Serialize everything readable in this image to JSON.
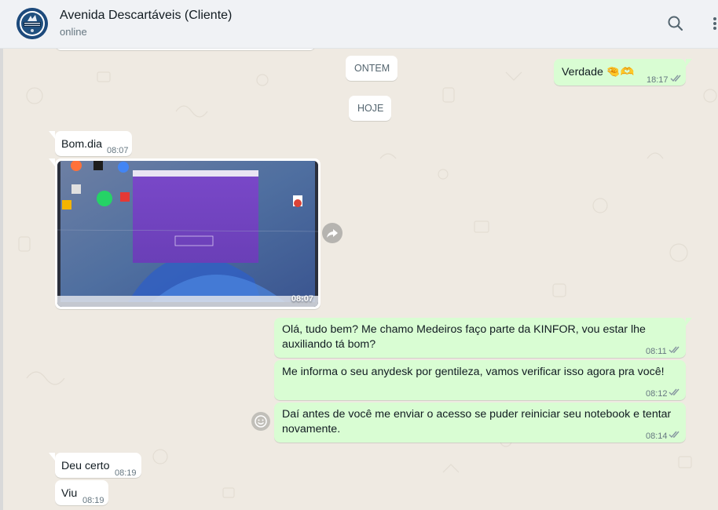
{
  "header": {
    "title": "Avenida Descartáveis (Cliente)",
    "status": "online",
    "search_icon": "search-icon",
    "menu_icon": "more-vertical-icon"
  },
  "chat": {
    "date_chips": [
      "ONTEM",
      "HOJE"
    ],
    "messages": [
      {
        "direction": "out",
        "text": "Verdade 🤏🫶",
        "time": "18:17",
        "status": "read"
      },
      {
        "direction": "in",
        "text": "Bom.dia",
        "time": "08:07"
      },
      {
        "direction": "in",
        "type": "image",
        "time": "08:07"
      },
      {
        "direction": "out",
        "text": "Olá, tudo bem? Me chamo Medeiros faço parte da KINFOR, vou estar lhe auxiliando tá bom?",
        "time": "08:11",
        "status": "read"
      },
      {
        "direction": "out",
        "text": "Me informa o seu anydesk por gentileza, vamos verificar isso agora pra você!",
        "time": "08:12",
        "status": "read"
      },
      {
        "direction": "out",
        "text": "Daí antes de você me enviar o acesso se puder reiniciar seu notebook e tentar novamente.",
        "time": "08:14",
        "status": "read"
      },
      {
        "direction": "in",
        "text": "Deu certo",
        "time": "08:19"
      },
      {
        "direction": "in",
        "text": "Viu",
        "time": "08:19"
      }
    ]
  },
  "colors": {
    "header_bg": "#f0f2f5",
    "chat_bg": "#efeae2",
    "incoming_bubble": "#ffffff",
    "outgoing_bubble": "#d9fdd3",
    "read_tick": "#8696a0",
    "image_bg": "#5e6b8a",
    "image_window": "#7b4bc7"
  }
}
